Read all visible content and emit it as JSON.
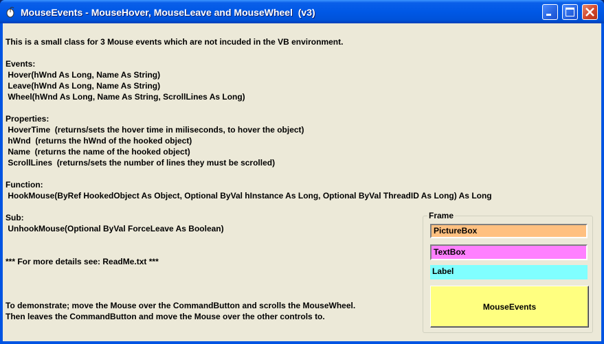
{
  "window": {
    "title": "MouseEvents - MouseHover, MouseLeave and MouseWheel  (v3)"
  },
  "info_lines": [
    "This is a small class for 3 Mouse events which are not incuded in the VB environment.",
    "",
    "Events:",
    " Hover(hWnd As Long, Name As String)",
    " Leave(hWnd As Long, Name As String)",
    " Wheel(hWnd As Long, Name As String, ScrollLines As Long)",
    "",
    "Properties:",
    " HoverTime  (returns/sets the hover time in miliseconds, to hover the object)",
    " hWnd  (returns the hWnd of the hooked object)",
    " Name  (returns the name of the hooked object)",
    " ScrollLines  (returns/sets the number of lines they must be scrolled)",
    "",
    "Function:",
    " HookMouse(ByRef HookedObject As Object, Optional ByVal hInstance As Long, Optional ByVal ThreadID As Long) As Long",
    "",
    "Sub:",
    " UnhookMouse(Optional ByVal ForceLeave As Boolean)",
    "",
    "",
    "*** For more details see: ReadMe.txt ***",
    "",
    "",
    "",
    "To demonstrate; move the Mouse over the CommandButton and scrolls the MouseWheel.",
    "Then leaves the CommandButton and move the Mouse over the other controls to."
  ],
  "frame": {
    "label": "Frame",
    "picturebox": "PictureBox",
    "textbox": "TextBox",
    "label_control": "Label",
    "command_button": "MouseEvents"
  },
  "colors": {
    "picturebox": "#ffc080",
    "textbox": "#ff80ff",
    "label": "#80ffff",
    "command_button": "#ffff80"
  }
}
